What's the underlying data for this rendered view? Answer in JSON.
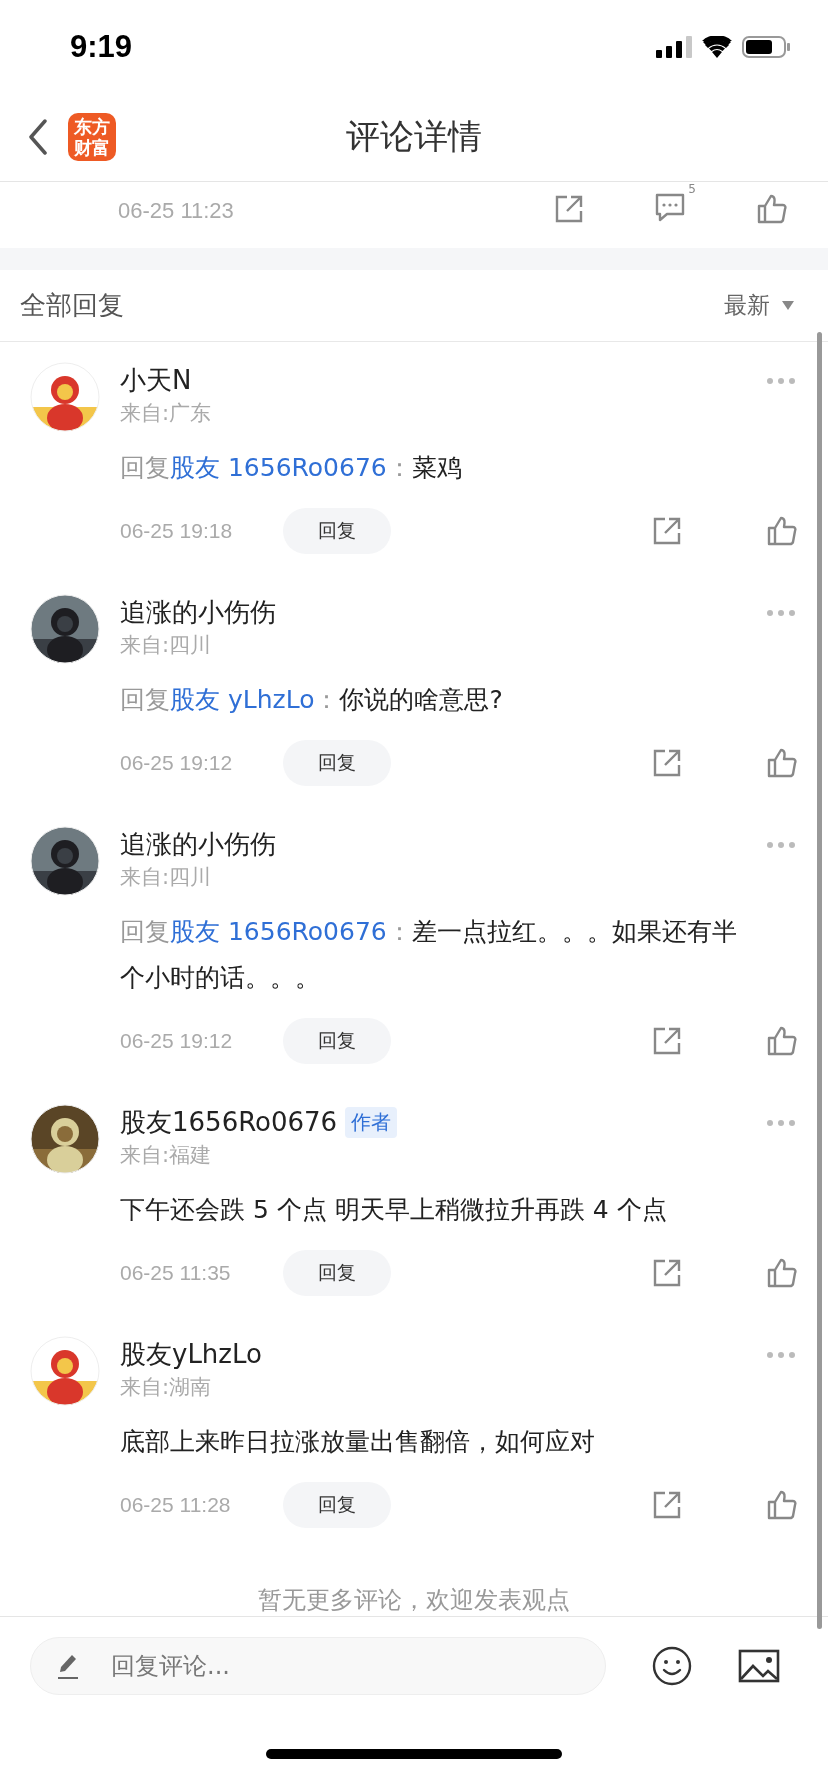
{
  "status_bar": {
    "time": "9:19"
  },
  "nav": {
    "logo": "东方财富",
    "title": "评论详情"
  },
  "parent_post": {
    "time": "06-25 11:23",
    "comment_count": "5"
  },
  "replies_header": {
    "title": "全部回复",
    "sort": "最新"
  },
  "comments": [
    {
      "name": "小天N",
      "location": "来自:广东",
      "reply_prefix": "回复",
      "reply_to": "股友 1656Ro0676",
      "separator": "：",
      "text": "菜鸡",
      "time": "06-25 19:18",
      "reply_button": "回复"
    },
    {
      "name": "追涨的小伤伤",
      "location": "来自:四川",
      "reply_prefix": "回复",
      "reply_to": "股友 yLhzLo",
      "separator": "：",
      "text": "你说的啥意思?",
      "time": "06-25 19:12",
      "reply_button": "回复"
    },
    {
      "name": "追涨的小伤伤",
      "location": "来自:四川",
      "reply_prefix": "回复",
      "reply_to": "股友 1656Ro0676",
      "separator": "：",
      "text": "差一点拉红。。。如果还有半个小时的话。。。",
      "time": "06-25 19:12",
      "reply_button": "回复"
    },
    {
      "name": "股友1656Ro0676",
      "badge": "作者",
      "location": "来自:福建",
      "text": "下午还会跌 5 个点 明天早上稍微拉升再跌 4 个点",
      "time": "06-25 11:35",
      "reply_button": "回复"
    },
    {
      "name": "股友yLhzLo",
      "location": "来自:湖南",
      "text": "底部上来昨日拉涨放量出售翻倍，如何应对",
      "time": "06-25 11:28",
      "reply_button": "回复"
    }
  ],
  "end_note": "暂无更多评论，欢迎发表观点",
  "composer": {
    "placeholder": "回复评论..."
  }
}
